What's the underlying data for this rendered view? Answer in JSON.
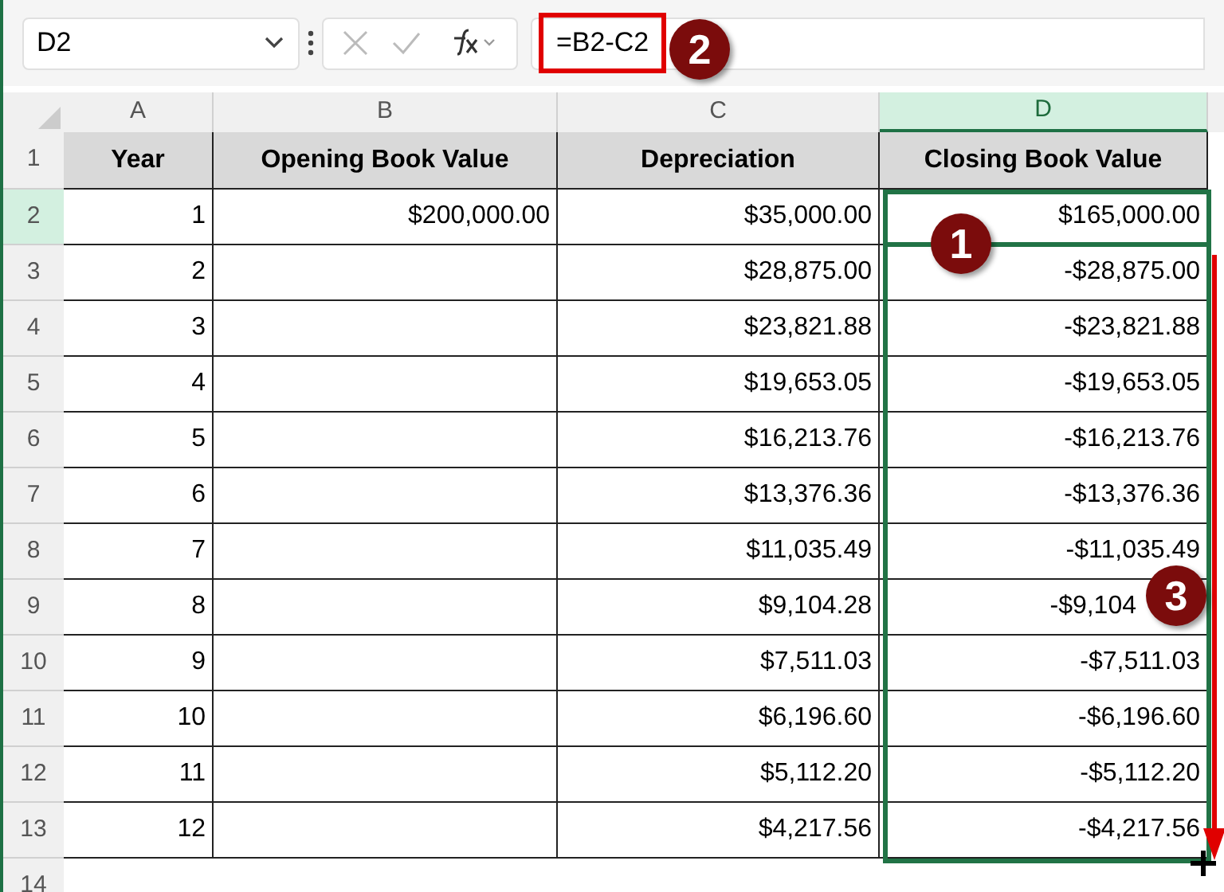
{
  "name_box": {
    "value": "D2"
  },
  "formula_bar": {
    "value": "=B2-C2"
  },
  "column_headers": [
    "A",
    "B",
    "C",
    "D"
  ],
  "header_row": {
    "number": "1",
    "cells": [
      "Year",
      "Opening Book Value",
      "Depreciation",
      "Closing Book Value"
    ]
  },
  "rows": [
    {
      "number": "2",
      "cells": [
        "1",
        "$200,000.00",
        "$35,000.00",
        "$165,000.00"
      ]
    },
    {
      "number": "3",
      "cells": [
        "2",
        "",
        "$28,875.00",
        "-$28,875.00"
      ]
    },
    {
      "number": "4",
      "cells": [
        "3",
        "",
        "$23,821.88",
        "-$23,821.88"
      ]
    },
    {
      "number": "5",
      "cells": [
        "4",
        "",
        "$19,653.05",
        "-$19,653.05"
      ]
    },
    {
      "number": "6",
      "cells": [
        "5",
        "",
        "$16,213.76",
        "-$16,213.76"
      ]
    },
    {
      "number": "7",
      "cells": [
        "6",
        "",
        "$13,376.36",
        "-$13,376.36"
      ]
    },
    {
      "number": "8",
      "cells": [
        "7",
        "",
        "$11,035.49",
        "-$11,035.49"
      ]
    },
    {
      "number": "9",
      "cells": [
        "8",
        "",
        "$9,104.28",
        "-$9,104"
      ]
    },
    {
      "number": "10",
      "cells": [
        "9",
        "",
        "$7,511.03",
        "-$7,511.03"
      ]
    },
    {
      "number": "11",
      "cells": [
        "10",
        "",
        "$6,196.60",
        "-$6,196.60"
      ]
    },
    {
      "number": "12",
      "cells": [
        "11",
        "",
        "$5,112.20",
        "-$5,112.20"
      ]
    },
    {
      "number": "13",
      "cells": [
        "12",
        "",
        "$4,217.56",
        "-$4,217.56"
      ]
    },
    {
      "number": "14",
      "cells": [
        "",
        "",
        "",
        ""
      ]
    }
  ],
  "callouts": [
    "1",
    "2",
    "3"
  ]
}
